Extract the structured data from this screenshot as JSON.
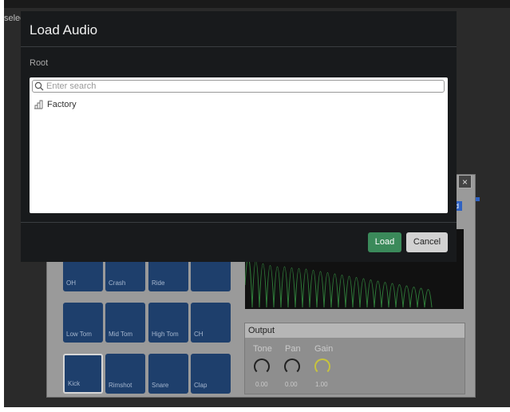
{
  "background": {
    "truncated_text": "selec",
    "pads": [
      {
        "label": "OH"
      },
      {
        "label": "Crash"
      },
      {
        "label": "Ride"
      },
      {
        "label": ""
      },
      {
        "label": "Low Tom"
      },
      {
        "label": "Mid Tom"
      },
      {
        "label": "High Tom"
      },
      {
        "label": "CH"
      },
      {
        "label": "Kick"
      },
      {
        "label": "Rimshot"
      },
      {
        "label": "Snare"
      },
      {
        "label": "Clap"
      }
    ],
    "output": {
      "title": "Output",
      "knobs": [
        {
          "label": "Tone",
          "value": "0.00"
        },
        {
          "label": "Pan",
          "value": "0.00"
        },
        {
          "label": "Gain",
          "value": "1.00"
        }
      ]
    },
    "close_glyph": "×",
    "badge_text": "d"
  },
  "dialog": {
    "title": "Load Audio",
    "breadcrumb": "Root",
    "search": {
      "placeholder": "Enter search",
      "value": ""
    },
    "tree": [
      {
        "label": "Factory",
        "icon": "folder-tree-icon"
      }
    ],
    "buttons": {
      "load": "Load",
      "cancel": "Cancel"
    }
  },
  "colors": {
    "load_button": "#3b8a5a",
    "pad": "#1e3f6c",
    "accent_blue": "#2f62c2",
    "gain_knob": "#c7c33d"
  }
}
